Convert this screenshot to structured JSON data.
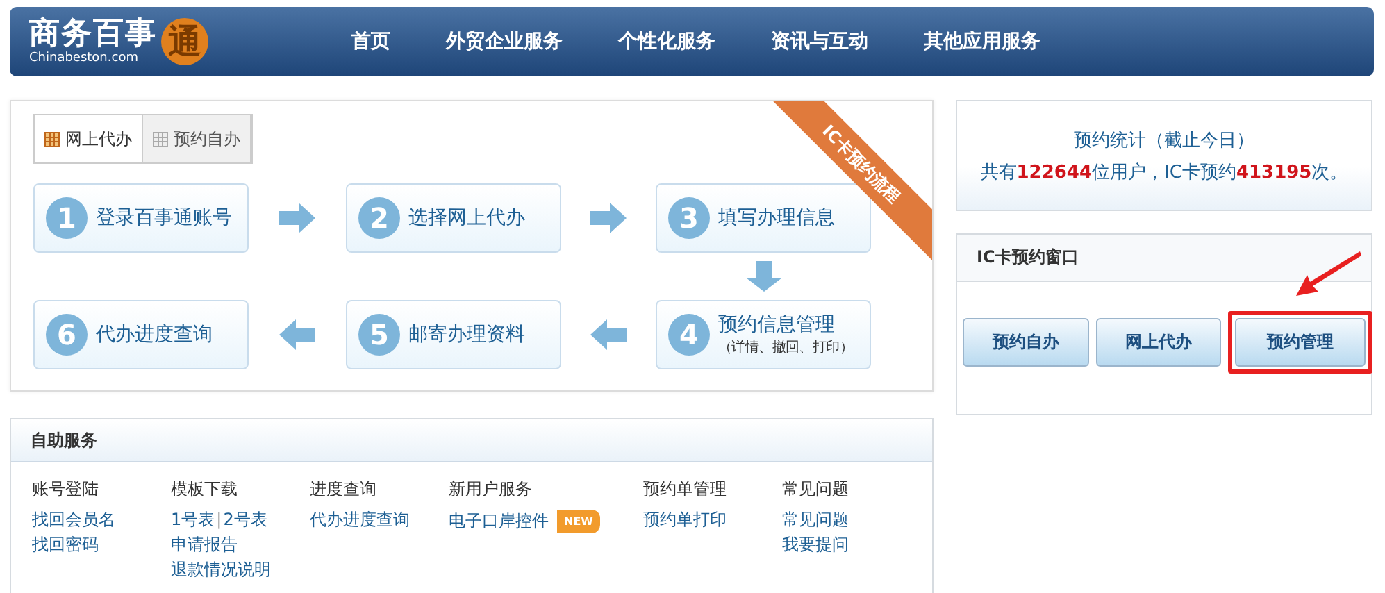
{
  "header": {
    "logo": {
      "title": "商务百事",
      "subtitle": "Chinabeston.com",
      "badge": "通"
    },
    "nav": [
      {
        "label": "首页"
      },
      {
        "label": "外贸企业服务"
      },
      {
        "label": "个性化服务"
      },
      {
        "label": "资讯与互动"
      },
      {
        "label": "其他应用服务"
      }
    ]
  },
  "flow_panel": {
    "tabs": [
      {
        "label": "网上代办",
        "selected": true
      },
      {
        "label": "预约自办",
        "selected": false
      }
    ],
    "ribbon": "IC卡预约流程",
    "steps": [
      {
        "number": "1",
        "title": "登录百事通账号"
      },
      {
        "number": "2",
        "title": "选择网上代办"
      },
      {
        "number": "3",
        "title": "填写办理信息"
      },
      {
        "number": "6",
        "title": "代办进度查询"
      },
      {
        "number": "5",
        "title": "邮寄办理资料"
      },
      {
        "number": "4",
        "title": "预约信息管理",
        "note": "（详情、撤回、打印）"
      }
    ]
  },
  "stats": {
    "heading": "预约统计（截止今日）",
    "text": "共有**122644**位用户，IC卡预约**413195**次。"
  },
  "ic_window": {
    "title": "IC卡预约窗口",
    "buttons": [
      {
        "label": "预约自办",
        "highlighted": false
      },
      {
        "label": "网上代办",
        "highlighted": false
      },
      {
        "label": "预约管理",
        "highlighted": true
      }
    ]
  },
  "self_service": {
    "title": "自助服务",
    "columns": [
      {
        "heading": "账号登陆",
        "rows": [
          [
            {
              "kind": "link",
              "text": "找回会员名"
            }
          ],
          [
            {
              "kind": "link",
              "text": "找回密码"
            }
          ]
        ]
      },
      {
        "heading": "模板下载",
        "rows": [
          [
            {
              "kind": "link",
              "text": "1号表"
            },
            {
              "kind": "sep",
              "text": "|"
            },
            {
              "kind": "link",
              "text": "2号表"
            }
          ],
          [
            {
              "kind": "link",
              "text": "申请报告"
            }
          ],
          [
            {
              "kind": "link",
              "text": "退款情况说明"
            }
          ]
        ]
      },
      {
        "heading": "进度查询",
        "rows": [
          [
            {
              "kind": "link",
              "text": "代办进度查询"
            }
          ]
        ]
      },
      {
        "heading": "新用户服务",
        "rows": [
          [
            {
              "kind": "link",
              "text": "电子口岸控件"
            },
            {
              "kind": "badge",
              "text": "NEW"
            }
          ]
        ]
      },
      {
        "heading": "预约单管理",
        "rows": [
          [
            {
              "kind": "link",
              "text": "预约单打印"
            }
          ]
        ]
      },
      {
        "heading": "常见问题",
        "rows": [
          [
            {
              "kind": "link",
              "text": "常见问题"
            }
          ],
          [
            {
              "kind": "link",
              "text": "我要提问"
            }
          ]
        ]
      }
    ]
  }
}
